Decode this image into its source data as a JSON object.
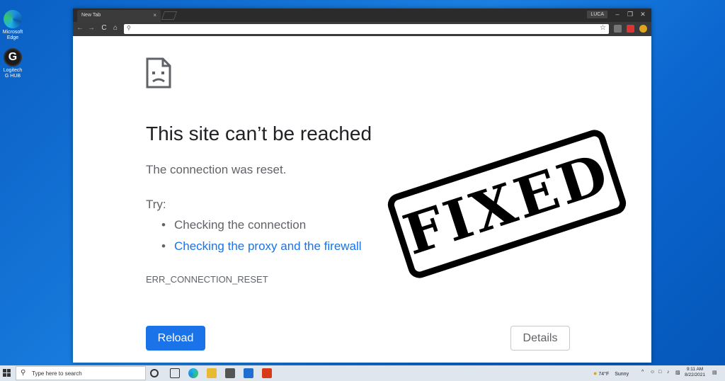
{
  "desktop": {
    "icons": [
      {
        "label": "Microsoft Edge"
      },
      {
        "label": "Logitech G HUB",
        "glyph": "G"
      }
    ]
  },
  "browser": {
    "tab_title": "New Tab",
    "tab_close": "×",
    "profile": "LUCA",
    "window_buttons": {
      "minimize": "–",
      "maximize": "❐",
      "close": "✕"
    },
    "nav": {
      "back": "←",
      "forward": "→",
      "reload": "C",
      "home": "⌂"
    },
    "omnibox_value": "",
    "star": "☆"
  },
  "error_page": {
    "title": "This site can’t be reached",
    "subtitle": "The connection was reset.",
    "try_label": "Try:",
    "suggestions": [
      {
        "text": "Checking the connection",
        "is_link": false
      },
      {
        "text": "Checking the proxy and the firewall",
        "is_link": true
      }
    ],
    "bullet": "•",
    "error_code": "ERR_CONNECTION_RESET",
    "reload_label": "Reload",
    "details_label": "Details"
  },
  "stamp": {
    "text": "FIXED"
  },
  "taskbar": {
    "search_placeholder": "Type here to search",
    "weather_temp": "74°F",
    "weather_desc": "Sunny",
    "time": "9:11 AM",
    "date": "8/22/2021"
  },
  "colors": {
    "link": "#1a73e8",
    "reload_button": "#1a73e8",
    "desktop": "#0a5fc4"
  }
}
